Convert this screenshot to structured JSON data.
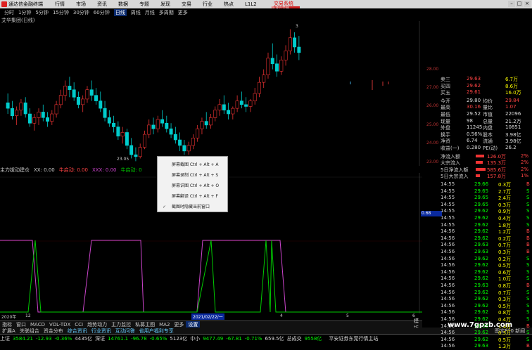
{
  "app": {
    "title": "通达信金融终端",
    "brand": "交易系统",
    "brand2": "极速云交易"
  },
  "menu": [
    "行情",
    "市场",
    "资讯",
    "数据",
    "专题",
    "发现",
    "交易",
    "行业",
    "热点",
    "L1L2"
  ],
  "periods": [
    "分时",
    "1分钟",
    "5分钟",
    "15分钟",
    "30分钟",
    "60分钟",
    "日线",
    "周线",
    "月线",
    "多周期",
    "更多"
  ],
  "period_active": "日线",
  "chart_title": "艾华集团(日线)",
  "candles": [
    {
      "o": 26.2,
      "h": 26.7,
      "l": 25.6,
      "c": 25.9
    },
    {
      "o": 25.9,
      "h": 26.3,
      "l": 25.3,
      "c": 25.5
    },
    {
      "o": 25.5,
      "h": 26.0,
      "l": 25.0,
      "c": 25.8
    },
    {
      "o": 25.8,
      "h": 26.4,
      "l": 25.5,
      "c": 26.2
    },
    {
      "o": 26.2,
      "h": 26.5,
      "l": 25.4,
      "c": 25.6
    },
    {
      "o": 25.6,
      "h": 25.9,
      "l": 24.9,
      "c": 25.1
    },
    {
      "o": 25.1,
      "h": 25.6,
      "l": 24.7,
      "c": 25.4
    },
    {
      "o": 25.4,
      "h": 25.9,
      "l": 25.0,
      "c": 25.7
    },
    {
      "o": 25.7,
      "h": 26.1,
      "l": 25.2,
      "c": 25.4
    },
    {
      "o": 25.4,
      "h": 25.7,
      "l": 24.9,
      "c": 25.2
    },
    {
      "o": 25.2,
      "h": 25.8,
      "l": 25.0,
      "c": 25.6
    },
    {
      "o": 25.6,
      "h": 26.3,
      "l": 25.4,
      "c": 26.1
    },
    {
      "o": 26.1,
      "h": 26.9,
      "l": 25.9,
      "c": 26.6
    },
    {
      "o": 26.6,
      "h": 27.4,
      "l": 26.3,
      "c": 27.1
    },
    {
      "o": 27.1,
      "h": 27.6,
      "l": 26.5,
      "c": 26.9
    },
    {
      "o": 26.9,
      "h": 27.3,
      "l": 26.3,
      "c": 26.5
    },
    {
      "o": 26.5,
      "h": 26.8,
      "l": 25.9,
      "c": 26.1
    },
    {
      "o": 26.1,
      "h": 26.6,
      "l": 25.7,
      "c": 26.4
    },
    {
      "o": 26.4,
      "h": 27.1,
      "l": 26.2,
      "c": 26.9
    },
    {
      "o": 26.9,
      "h": 27.4,
      "l": 26.3,
      "c": 26.6
    },
    {
      "o": 26.6,
      "h": 27.0,
      "l": 26.1,
      "c": 26.3
    },
    {
      "o": 26.3,
      "h": 26.8,
      "l": 25.7,
      "c": 25.9
    },
    {
      "o": 25.9,
      "h": 26.3,
      "l": 25.2,
      "c": 25.4
    },
    {
      "o": 25.4,
      "h": 25.8,
      "l": 24.9,
      "c": 25.1
    },
    {
      "o": 25.1,
      "h": 25.5,
      "l": 24.6,
      "c": 24.9
    },
    {
      "o": 24.9,
      "h": 25.2,
      "l": 24.2,
      "c": 24.4
    },
    {
      "o": 24.4,
      "h": 24.9,
      "l": 24.0,
      "c": 24.6
    },
    {
      "o": 24.6,
      "h": 24.8,
      "l": 23.7,
      "c": 23.9
    },
    {
      "o": 23.9,
      "h": 24.3,
      "l": 23.2,
      "c": 23.4
    },
    {
      "o": 23.4,
      "h": 23.8,
      "l": 23.05,
      "c": 23.3
    },
    {
      "o": 23.3,
      "h": 24.0,
      "l": 23.2,
      "c": 23.8
    },
    {
      "o": 23.8,
      "h": 24.7,
      "l": 23.7,
      "c": 24.5
    },
    {
      "o": 24.5,
      "h": 25.3,
      "l": 24.3,
      "c": 25.0
    },
    {
      "o": 25.0,
      "h": 25.4,
      "l": 24.5,
      "c": 24.8
    },
    {
      "o": 24.8,
      "h": 25.5,
      "l": 24.6,
      "c": 25.3
    },
    {
      "o": 25.3,
      "h": 25.8,
      "l": 24.9,
      "c": 25.1
    },
    {
      "o": 25.1,
      "h": 25.5,
      "l": 24.6,
      "c": 24.8
    },
    {
      "o": 24.8,
      "h": 25.1,
      "l": 24.3,
      "c": 24.5
    },
    {
      "o": 24.5,
      "h": 24.9,
      "l": 24.0,
      "c": 24.2
    },
    {
      "o": 24.2,
      "h": 24.6,
      "l": 23.6,
      "c": 23.9
    },
    {
      "o": 23.9,
      "h": 24.2,
      "l": 23.4,
      "c": 23.6
    },
    {
      "o": 23.6,
      "h": 24.1,
      "l": 23.4,
      "c": 23.9
    },
    {
      "o": 23.9,
      "h": 24.5,
      "l": 23.7,
      "c": 24.3
    },
    {
      "o": 24.3,
      "h": 25.0,
      "l": 24.1,
      "c": 24.8
    },
    {
      "o": 24.8,
      "h": 25.4,
      "l": 24.5,
      "c": 25.2
    },
    {
      "o": 25.2,
      "h": 25.7,
      "l": 24.8,
      "c": 25.0
    },
    {
      "o": 25.0,
      "h": 25.6,
      "l": 24.8,
      "c": 25.4
    },
    {
      "o": 25.4,
      "h": 26.0,
      "l": 25.2,
      "c": 25.8
    },
    {
      "o": 25.8,
      "h": 26.4,
      "l": 25.5,
      "c": 26.1
    },
    {
      "o": 26.1,
      "h": 26.6,
      "l": 25.6,
      "c": 25.8
    },
    {
      "o": 25.8,
      "h": 26.2,
      "l": 25.3,
      "c": 25.6
    },
    {
      "o": 25.6,
      "h": 26.0,
      "l": 25.3,
      "c": 25.9
    },
    {
      "o": 25.9,
      "h": 26.6,
      "l": 25.7,
      "c": 26.3
    },
    {
      "o": 26.3,
      "h": 26.8,
      "l": 25.9,
      "c": 26.1
    },
    {
      "o": 26.1,
      "h": 26.5,
      "l": 25.7,
      "c": 26.0
    },
    {
      "o": 26.0,
      "h": 26.4,
      "l": 25.7,
      "c": 26.3
    },
    {
      "o": 26.3,
      "h": 27.0,
      "l": 26.1,
      "c": 26.7
    },
    {
      "o": 26.7,
      "h": 27.6,
      "l": 26.5,
      "c": 27.3
    },
    {
      "o": 27.3,
      "h": 28.0,
      "l": 27.0,
      "c": 27.7
    },
    {
      "o": 27.7,
      "h": 28.9,
      "l": 27.5,
      "c": 28.6
    },
    {
      "o": 28.6,
      "h": 29.4,
      "l": 28.0,
      "c": 28.3
    },
    {
      "o": 28.3,
      "h": 28.8,
      "l": 27.6,
      "c": 27.9
    },
    {
      "o": 27.9,
      "h": 28.7,
      "l": 27.7,
      "c": 28.5
    },
    {
      "o": 28.5,
      "h": 29.3,
      "l": 28.2,
      "c": 29.0
    },
    {
      "o": 29.0,
      "h": 30.16,
      "l": 28.8,
      "c": 29.7
    },
    {
      "o": 29.7,
      "h": 30.0,
      "l": 28.9,
      "c": 29.2
    },
    {
      "o": 29.2,
      "h": 29.8,
      "l": 28.5,
      "c": 28.9
    }
  ],
  "price_axis": [
    "28.00",
    "27.00",
    "26.00",
    "25.00",
    "24.00",
    "23.00"
  ],
  "hi_label": "3",
  "lo_label": "23.05",
  "indicator": {
    "name": "主力拔动建仓",
    "k1": "XX: 0.00",
    "k2": "牛启动: 0.00",
    "k3": "XXX: 0.00",
    "k4": "牛启动: 0"
  },
  "osc_value": "0.68",
  "ind_x": [
    0,
    0.5,
    1
  ],
  "ctx_menu": [
    {
      "label": "屏幕截图 Ctrl + Alt + A",
      "checked": false
    },
    {
      "label": "屏幕录制 Ctrl + Alt + S",
      "checked": false
    },
    {
      "label": "屏幕识图 Ctrl + Alt + O",
      "checked": false
    },
    {
      "label": "屏幕翻译 Ctrl + Alt + F",
      "checked": false
    },
    {
      "label": "截图时隐藏当前窗口",
      "checked": true
    }
  ],
  "quote": {
    "asks": [
      {
        "n": "卖三",
        "p": "29.63",
        "v": "6.7万"
      },
      {
        "n": "买四",
        "p": "29.62",
        "v": "8.6万"
      },
      {
        "n": "买五",
        "p": "29.61",
        "v": "16.0万"
      }
    ],
    "rows": [
      {
        "a": "今开",
        "b": "29.80",
        "c": "均价",
        "d": "29.84"
      },
      {
        "a": "最高",
        "b": "30.16",
        "c": "量比",
        "d": "1.07"
      },
      {
        "a": "最低",
        "b": "29.52",
        "c": "市值",
        "d": "22096"
      },
      {
        "a": "现量",
        "b": "98",
        "c": "总量",
        "d": "21.2万"
      },
      {
        "a": "外盘",
        "b": "11245",
        "c": "内盘",
        "d": "10851"
      },
      {
        "a": "换手",
        "b": "0.56%",
        "c": "股本",
        "d": "3.98亿"
      },
      {
        "a": "净资",
        "b": "6.74",
        "c": "流通",
        "d": "3.98亿"
      },
      {
        "a": "收益(一)",
        "b": "0.280",
        "c": "PE(动)",
        "d": "26.2"
      }
    ],
    "flows": [
      {
        "n": "净流入额",
        "v": "126.0万",
        "p": "2%"
      },
      {
        "n": "大宗流入",
        "v": "135.3万",
        "p": "2%"
      },
      {
        "n": "5日净流入额",
        "v": "585.6万",
        "p": "2%"
      },
      {
        "n": "5日大宗流入",
        "v": "157.8万",
        "p": "1%"
      }
    ]
  },
  "ticks": [
    {
      "t": "14:55",
      "p": "29.66",
      "v": "0.3万",
      "s": "B"
    },
    {
      "t": "14:55",
      "p": "29.65",
      "v": "2.7万",
      "s": "S"
    },
    {
      "t": "14:55",
      "p": "29.65",
      "v": "2.4万",
      "s": "S"
    },
    {
      "t": "14:55",
      "p": "29.65",
      "v": "0.3万",
      "s": "S"
    },
    {
      "t": "14:55",
      "p": "29.62",
      "v": "0.9万",
      "s": "S"
    },
    {
      "t": "14:55",
      "p": "29.62",
      "v": "0.4万",
      "s": "S"
    },
    {
      "t": "14:55",
      "p": "29.62",
      "v": "1.8万",
      "s": "S"
    },
    {
      "t": "14:56",
      "p": "29.62",
      "v": "1.2万",
      "s": "B"
    },
    {
      "t": "14:56",
      "p": "29.62",
      "v": "0.2万",
      "s": "B"
    },
    {
      "t": "14:56",
      "p": "29.63",
      "v": "0.7万",
      "s": "B"
    },
    {
      "t": "14:56",
      "p": "29.63",
      "v": "0.3万",
      "s": "B"
    },
    {
      "t": "14:56",
      "p": "29.62",
      "v": "0.2万",
      "s": "S"
    },
    {
      "t": "14:56",
      "p": "29.62",
      "v": "0.5万",
      "s": "S"
    },
    {
      "t": "14:56",
      "p": "29.62",
      "v": "0.6万",
      "s": "S"
    },
    {
      "t": "14:56",
      "p": "29.62",
      "v": "1.0万",
      "s": "S"
    },
    {
      "t": "14:56",
      "p": "29.63",
      "v": "0.8万",
      "s": "B"
    },
    {
      "t": "14:56",
      "p": "29.62",
      "v": "0.7万",
      "s": "S"
    },
    {
      "t": "14:56",
      "p": "29.62",
      "v": "0.3万",
      "s": "S"
    },
    {
      "t": "14:56",
      "p": "29.62",
      "v": "0.5万",
      "s": "S"
    },
    {
      "t": "14:56",
      "p": "29.62",
      "v": "0.8万",
      "s": "S"
    },
    {
      "t": "14:56",
      "p": "29.62",
      "v": "0.4万",
      "s": "S"
    },
    {
      "t": "14:56",
      "p": "29.63",
      "v": "1.4万",
      "s": "B"
    },
    {
      "t": "14:56",
      "p": "29.62",
      "v": "0.3万",
      "s": "S"
    },
    {
      "t": "14:56",
      "p": "29.62",
      "v": "0.5万",
      "s": "S"
    },
    {
      "t": "14:56",
      "p": "29.63",
      "v": "1.3万",
      "s": "B"
    }
  ],
  "xaxis": {
    "a": "2020年",
    "b": "12",
    "c": "2021/02/22/一",
    "d": "4",
    "e": "5",
    "f": "6"
  },
  "tabs1": [
    "指标",
    "窗口",
    "MACD",
    "VOL-TDX",
    "CCI",
    "趋势动力",
    "主力监控",
    "私募主图",
    "MA2",
    "更多",
    "设置"
  ],
  "tabs1_active": "设置",
  "tabs1_right": "模板",
  "tabs2": [
    "扩展A",
    "关联组合",
    "资金分布",
    "综合资讯",
    "行业资讯",
    "互动问答",
    "省用户福利专享"
  ],
  "tabs2_right": "图文F10 新闻",
  "status": [
    {
      "name": "上证",
      "v": "3584.21",
      "c": "-12.93",
      "p": "-0.36%",
      "a": "4435亿"
    },
    {
      "name": "深证",
      "v": "14761.1",
      "c": "-96.78",
      "p": "-0.65%",
      "a": "5123亿"
    },
    {
      "name": "中小",
      "v": "9477.49",
      "c": "-67.81",
      "p": "-0.71%",
      "a": "659.5亿"
    },
    {
      "name": "总成交",
      "v": "9558亿"
    }
  ],
  "status_right": "平安证券东莞行情主站",
  "watermark": "www.7gpzb.com"
}
